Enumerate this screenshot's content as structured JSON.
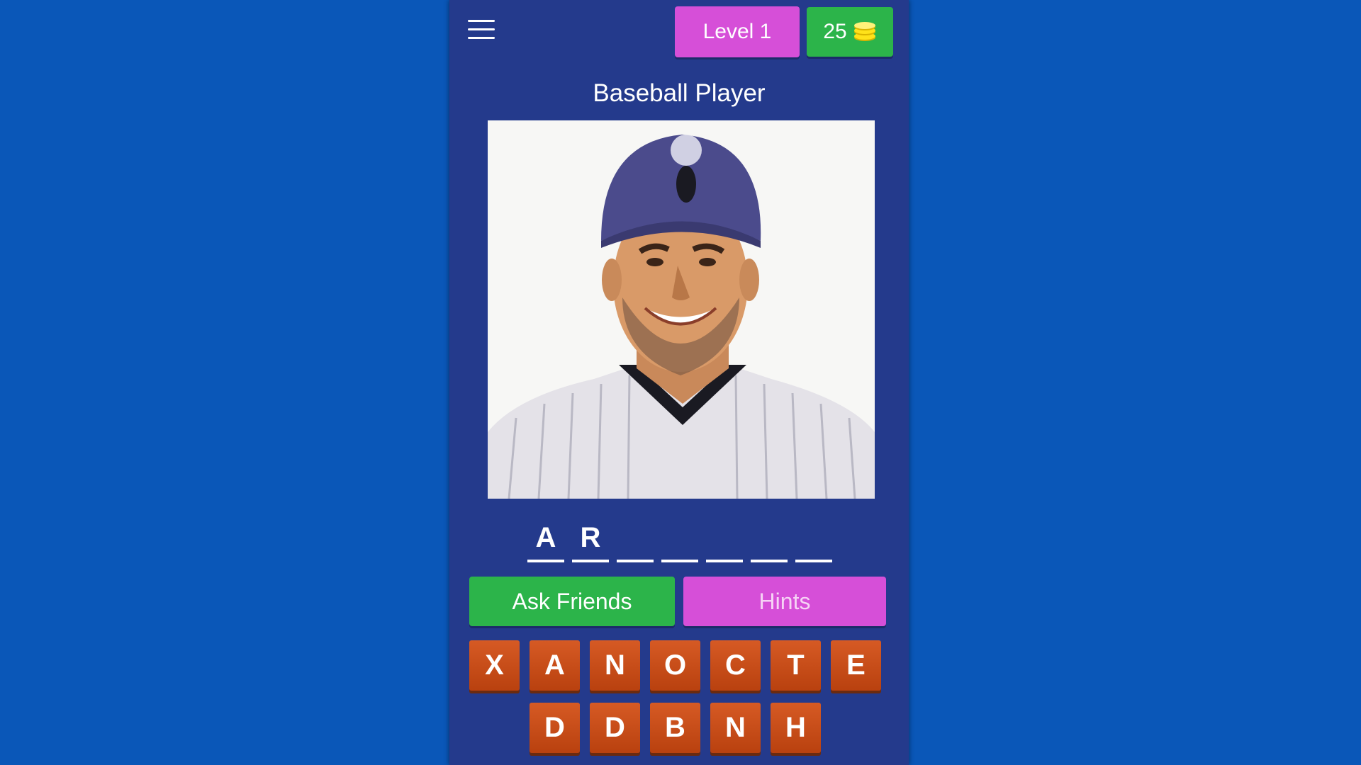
{
  "header": {
    "menu_icon": "hamburger-menu-icon",
    "level_label": "Level 1",
    "coins": "25",
    "coin_icon": "coin-stack-icon"
  },
  "category": "Baseball Player",
  "answer": {
    "slots": [
      "A",
      "R",
      "",
      "",
      "",
      "",
      ""
    ]
  },
  "buttons": {
    "ask_friends": "Ask Friends",
    "hints": "Hints"
  },
  "keyboard": {
    "row1": [
      "X",
      "A",
      "N",
      "O",
      "C",
      "T",
      "E"
    ],
    "row2": [
      "D",
      "D",
      "B",
      "N",
      "H"
    ]
  },
  "colors": {
    "background": "#0a57b8",
    "panel": "#243a8c",
    "green": "#2cb44a",
    "magenta": "#d64fd8",
    "tile": "#c84c19"
  }
}
